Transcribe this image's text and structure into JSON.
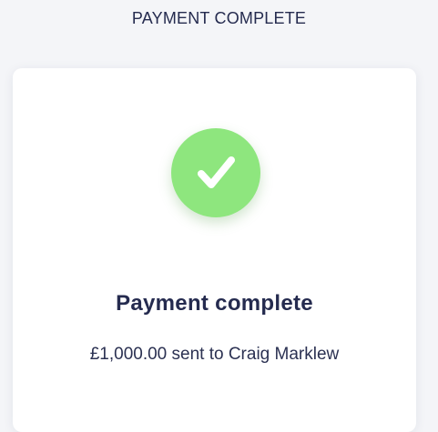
{
  "header": {
    "title": "PAYMENT COMPLETE"
  },
  "status": {
    "icon": "check-icon",
    "accent_color": "#8ee67e",
    "title": "Payment complete",
    "detail": "£1,000.00 sent to Craig Marklew"
  }
}
